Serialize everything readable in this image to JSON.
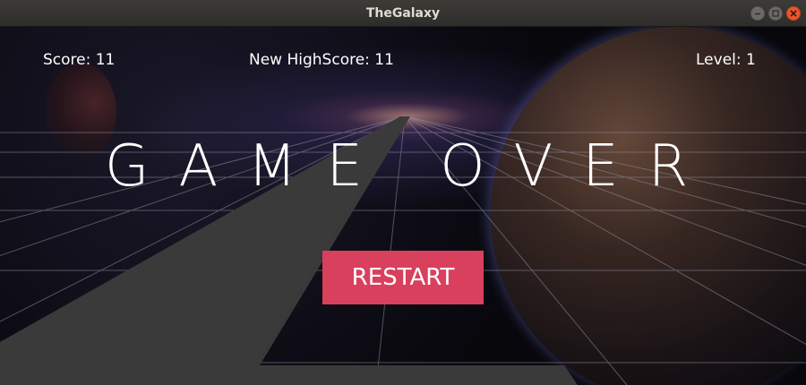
{
  "window": {
    "title": "TheGalaxy",
    "controls": [
      "minimize",
      "maximize",
      "close"
    ]
  },
  "hud": {
    "score": "Score: 11",
    "highscore": "New HighScore: 11",
    "level": "Level: 1"
  },
  "main": {
    "game_over": "GAME OVER",
    "restart_label": "RESTART"
  },
  "colors": {
    "restart_button": "#d9405e",
    "road": "#3a3a3a",
    "grid": "#8c8c9a"
  }
}
